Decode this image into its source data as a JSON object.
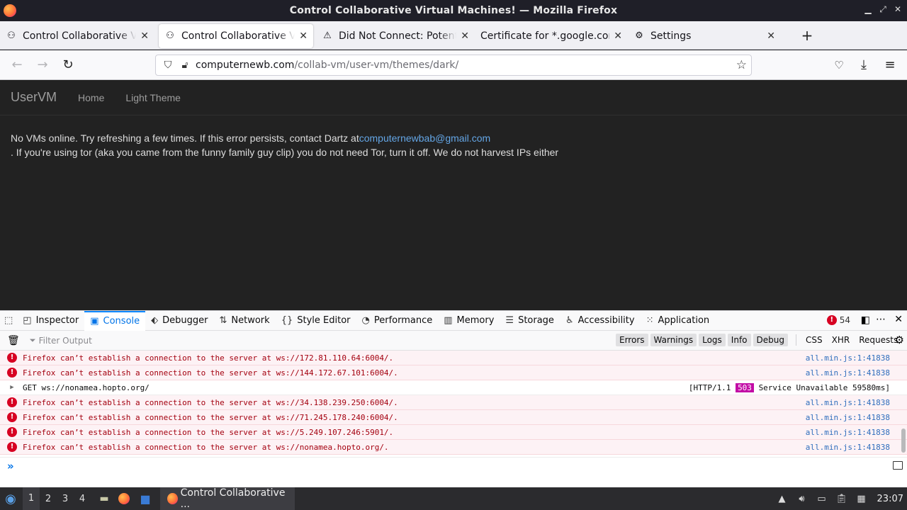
{
  "window": {
    "title": "Control Collaborative Virtual Machines! — Mozilla Firefox"
  },
  "tabs": [
    {
      "label": "Control Collaborative Virtual Machines!",
      "icon": "collab-vm-icon",
      "active": false
    },
    {
      "label": "Control Collaborative Virtual Machines!",
      "icon": "collab-vm-icon",
      "active": true
    },
    {
      "label": "Did Not Connect: Potential Security Issue",
      "icon": "warning-icon",
      "active": false
    },
    {
      "label": "Certificate for *.google.com",
      "icon": "",
      "active": false
    },
    {
      "label": "Settings",
      "icon": "gear-icon",
      "active": false
    }
  ],
  "urlbar": {
    "domain": "computernewb.com",
    "path": "/collab-vm/user-vm/themes/dark/"
  },
  "page": {
    "brand": "UserVM",
    "nav": [
      "Home",
      "Light Theme"
    ],
    "message_prefix": "No VMs online. Try refreshing a few times. If this error persists, contact Dartz at",
    "email": "computernewbab@gmail.com",
    "message_suffix": ". If you're using tor (aka you came from the funny family guy clip) you do not need Tor, turn it off. We do not harvest IPs either"
  },
  "devtools": {
    "tabs": [
      "Inspector",
      "Console",
      "Debugger",
      "Network",
      "Style Editor",
      "Performance",
      "Memory",
      "Storage",
      "Accessibility",
      "Application"
    ],
    "active_tab": "Console",
    "error_count": "54",
    "filter_placeholder": "Filter Output",
    "filters": [
      "Errors",
      "Warnings",
      "Logs",
      "Info",
      "Debug"
    ],
    "extra_filters": [
      "CSS",
      "XHR",
      "Requests"
    ]
  },
  "console": {
    "rows": [
      {
        "type": "error",
        "text": "Firefox can’t establish a connection to the server at ws://172.81.110.64:6004/.",
        "source": "all.min.js:1:41838"
      },
      {
        "type": "error",
        "text": "Firefox can’t establish a connection to the server at ws://144.172.67.101:6004/.",
        "source": "all.min.js:1:41838"
      },
      {
        "type": "network",
        "text": "GET ws://nonamea.hopto.org/",
        "info_prefix": "[HTTP/1.1",
        "status": "503",
        "info_suffix": "Service Unavailable 59580ms]"
      },
      {
        "type": "error",
        "text": "Firefox can’t establish a connection to the server at ws://34.138.239.250:6004/.",
        "source": "all.min.js:1:41838"
      },
      {
        "type": "error",
        "text": "Firefox can’t establish a connection to the server at ws://71.245.178.240:6004/.",
        "source": "all.min.js:1:41838"
      },
      {
        "type": "error",
        "text": "Firefox can’t establish a connection to the server at ws://5.249.107.246:5901/.",
        "source": "all.min.js:1:41838"
      },
      {
        "type": "error",
        "text": "Firefox can’t establish a connection to the server at ws://nonamea.hopto.org/.",
        "source": "all.min.js:1:41838"
      }
    ]
  },
  "taskbar": {
    "workspaces": [
      "1",
      "2",
      "3",
      "4"
    ],
    "active_workspace": "1",
    "task_label": "Control Collaborative ...",
    "clock": "23:07"
  },
  "colors": {
    "page_bg": "#222222",
    "link": "#64a6e6",
    "devtools_accent": "#0074e8",
    "error_text": "#a4000f",
    "status_503": "#c20ba5"
  }
}
